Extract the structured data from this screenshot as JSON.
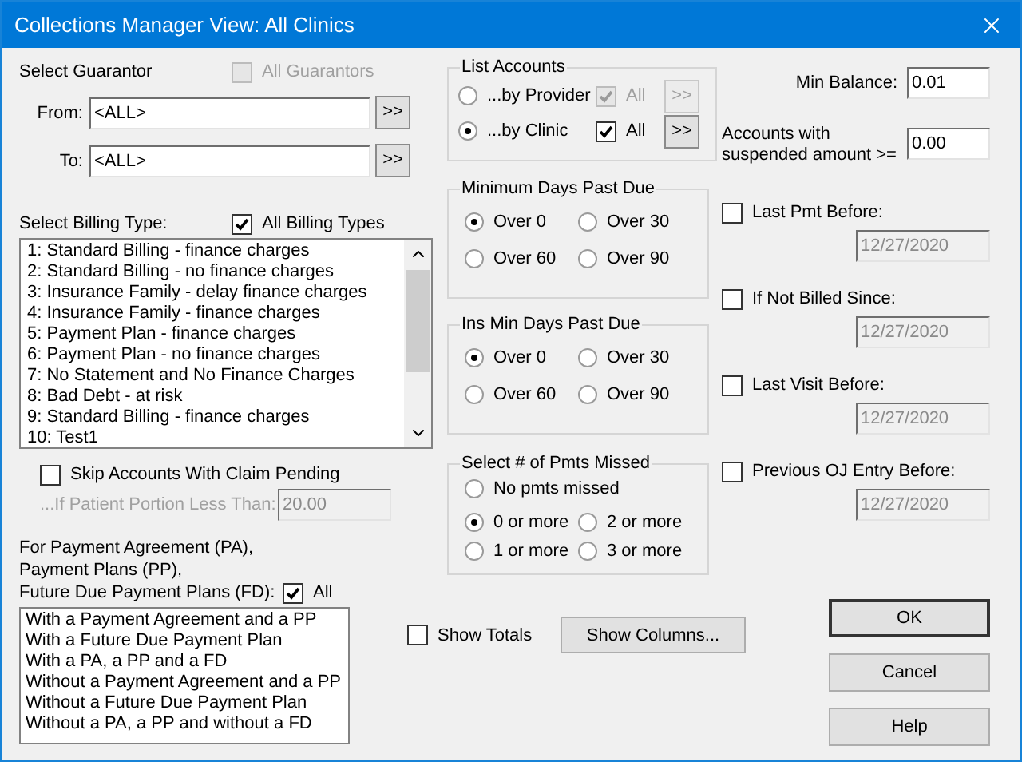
{
  "window": {
    "title": "Collections Manager View:  All Clinics"
  },
  "guarantor": {
    "label": "Select Guarantor",
    "all": {
      "label": "All Guarantors",
      "checked": false,
      "disabled": true
    },
    "from": {
      "label": "From:",
      "value": "<ALL>",
      "button": ">>"
    },
    "to": {
      "label": "To:",
      "value": "<ALL>",
      "button": ">>"
    }
  },
  "billing": {
    "label": "Select Billing Type:",
    "all": {
      "label": "All Billing Types",
      "checked": true
    },
    "items": [
      "1: Standard Billing - finance charges",
      "2: Standard Billing - no finance charges",
      "3: Insurance Family - delay finance charges",
      "4: Insurance Family - finance charges",
      "5: Payment Plan - finance charges",
      "6: Payment Plan - no finance charges",
      "7: No Statement and No Finance Charges",
      "8: Bad Debt - at risk",
      "9: Standard Billing - finance charges",
      "10: Test1"
    ]
  },
  "skip_claim": {
    "label": "Skip Accounts With Claim Pending",
    "checked": false
  },
  "patient_portion": {
    "label": "...If Patient Portion Less Than:",
    "value": "20.00",
    "disabled": true
  },
  "payment_plans": {
    "label_lines": [
      "For Payment Agreement (PA),",
      "Payment Plans (PP),",
      "Future Due Payment Plans (FD):"
    ],
    "all": {
      "label": "All",
      "checked": true
    },
    "items": [
      "With a Payment Agreement and a PP",
      "With a Future Due Payment Plan",
      "With a PA, a PP and a FD",
      "Without a Payment Agreement and a PP",
      "Without a Future Due Payment Plan",
      "Without a PA, a PP and without a FD"
    ]
  },
  "list_accounts": {
    "title": "List Accounts",
    "options": [
      {
        "label": "...by Provider",
        "selected": false,
        "all": {
          "label": "All",
          "checked": true,
          "disabled": true
        },
        "button": ">>",
        "button_disabled": true
      },
      {
        "label": "...by Clinic",
        "selected": true,
        "all": {
          "label": "All",
          "checked": true,
          "disabled": false
        },
        "button": ">>",
        "button_disabled": false
      }
    ]
  },
  "day_groups": [
    {
      "title": "Minimum Days Past Due",
      "options": [
        {
          "label": "Over 0",
          "selected": true
        },
        {
          "label": "Over 30",
          "selected": false
        },
        {
          "label": "Over 60",
          "selected": false
        },
        {
          "label": "Over 90",
          "selected": false
        }
      ]
    },
    {
      "title": "Ins Min Days Past Due",
      "options": [
        {
          "label": "Over 0",
          "selected": true
        },
        {
          "label": "Over 30",
          "selected": false
        },
        {
          "label": "Over 60",
          "selected": false
        },
        {
          "label": "Over 90",
          "selected": false
        }
      ]
    }
  ],
  "pmts_missed": {
    "title": "Select # of Pmts Missed",
    "options": [
      {
        "label": "No pmts missed",
        "selected": false
      },
      {
        "label": "0 or more",
        "selected": true
      },
      {
        "label": "2 or more",
        "selected": false
      },
      {
        "label": "1 or more",
        "selected": false
      },
      {
        "label": "3 or more",
        "selected": false
      }
    ]
  },
  "show_totals": {
    "label": "Show Totals",
    "checked": false
  },
  "show_columns_button": "Show Columns...",
  "min_balance": {
    "label": "Min Balance:",
    "value": "0.01"
  },
  "suspended": {
    "label_lines": [
      "Accounts with",
      "suspended amount >="
    ],
    "value": "0.00"
  },
  "date_filters": [
    {
      "label": "Last Pmt Before:",
      "checked": false,
      "value": "12/27/2020",
      "disabled": true
    },
    {
      "label": "If Not Billed Since:",
      "checked": false,
      "value": "12/27/2020",
      "disabled": true
    },
    {
      "label": "Last Visit Before:",
      "checked": false,
      "value": "12/27/2020",
      "disabled": true
    },
    {
      "label": "Previous OJ Entry Before:",
      "checked": false,
      "value": "12/27/2020",
      "disabled": true
    }
  ],
  "buttons": [
    {
      "label": "OK",
      "default": true
    },
    {
      "label": "Cancel",
      "default": false
    },
    {
      "label": "Help",
      "default": false
    }
  ]
}
